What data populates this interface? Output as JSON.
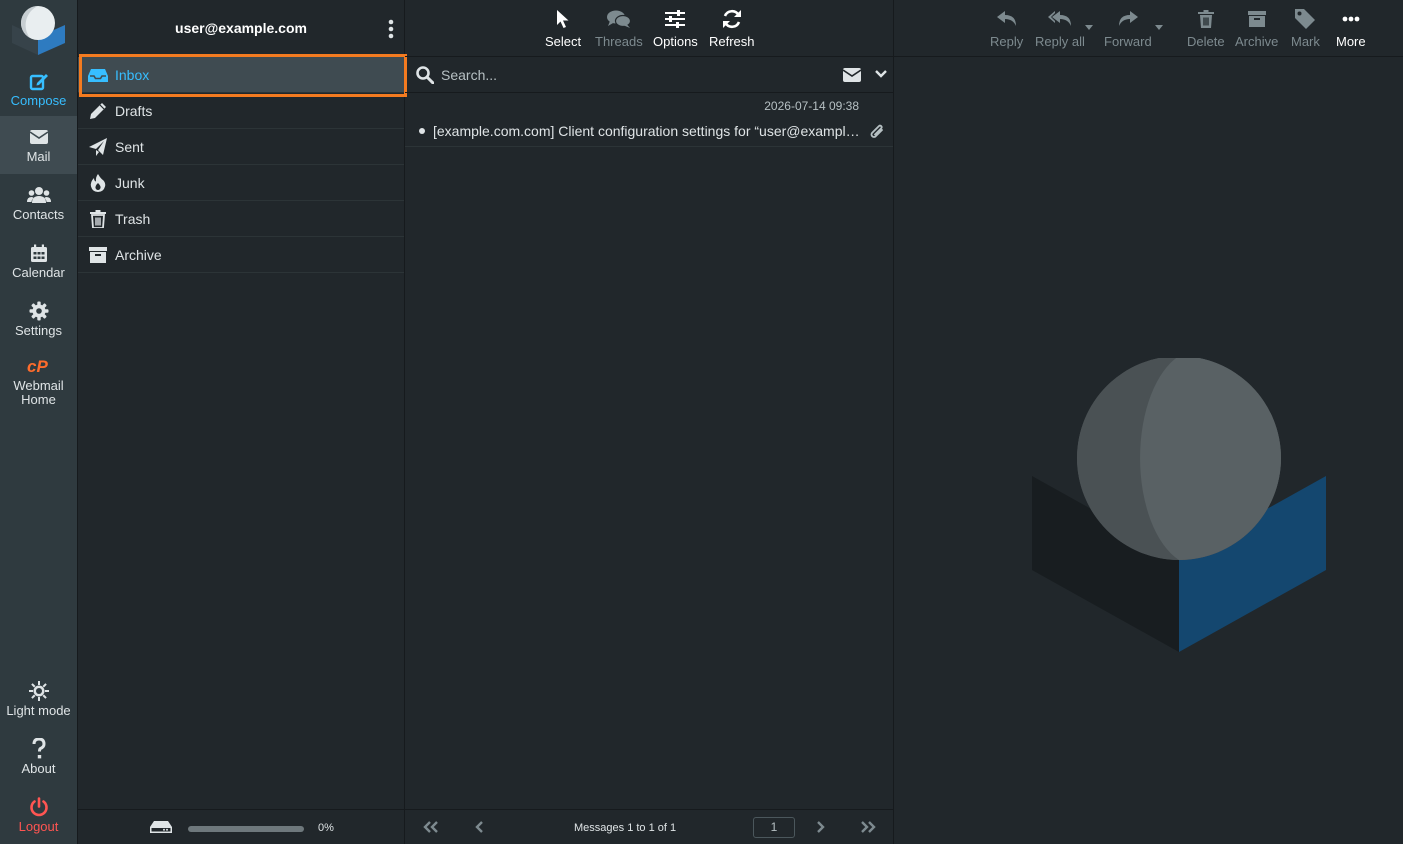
{
  "app_nav": {
    "compose": "Compose",
    "mail": "Mail",
    "contacts": "Contacts",
    "calendar": "Calendar",
    "settings": "Settings",
    "webmail_home": "Webmail Home",
    "light_mode": "Light mode",
    "about": "About",
    "logout": "Logout"
  },
  "folders": {
    "account": "user@example.com",
    "items": [
      {
        "label": "Inbox",
        "icon": "inbox-icon",
        "selected": true
      },
      {
        "label": "Drafts",
        "icon": "pencil-icon"
      },
      {
        "label": "Sent",
        "icon": "paper-plane-icon"
      },
      {
        "label": "Junk",
        "icon": "fire-icon"
      },
      {
        "label": "Trash",
        "icon": "trash-icon"
      },
      {
        "label": "Archive",
        "icon": "archive-box-icon"
      }
    ],
    "quota_text": "0%",
    "quota_fraction": 0
  },
  "list_toolbar": {
    "select": "Select",
    "threads": "Threads",
    "options": "Options",
    "refresh": "Refresh"
  },
  "search": {
    "placeholder": "Search..."
  },
  "messages": [
    {
      "date": "2026-07-14 09:38",
      "subject": "[example.com.com] Client configuration settings for “user@example.com”",
      "has_attachment": true
    }
  ],
  "pager": {
    "count_text": "Messages 1 to 1 of 1",
    "page": "1"
  },
  "message_toolbar": {
    "reply": "Reply",
    "reply_all": "Reply all",
    "forward": "Forward",
    "delete": "Delete",
    "archive": "Archive",
    "mark": "Mark",
    "more": "More"
  },
  "colors": {
    "accent": "#37beff",
    "highlight_border": "#f47b20",
    "logout": "#ff5552",
    "cpanel": "#ff6c2c"
  }
}
